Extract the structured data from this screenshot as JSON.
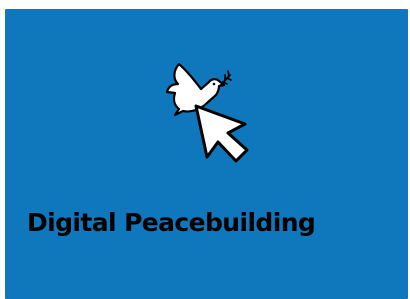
{
  "tile": {
    "title": "Digital Peacebuilding",
    "icon": "dove-with-cursor-icon",
    "background_color": "#0f77bb",
    "text_color": "#000000"
  }
}
